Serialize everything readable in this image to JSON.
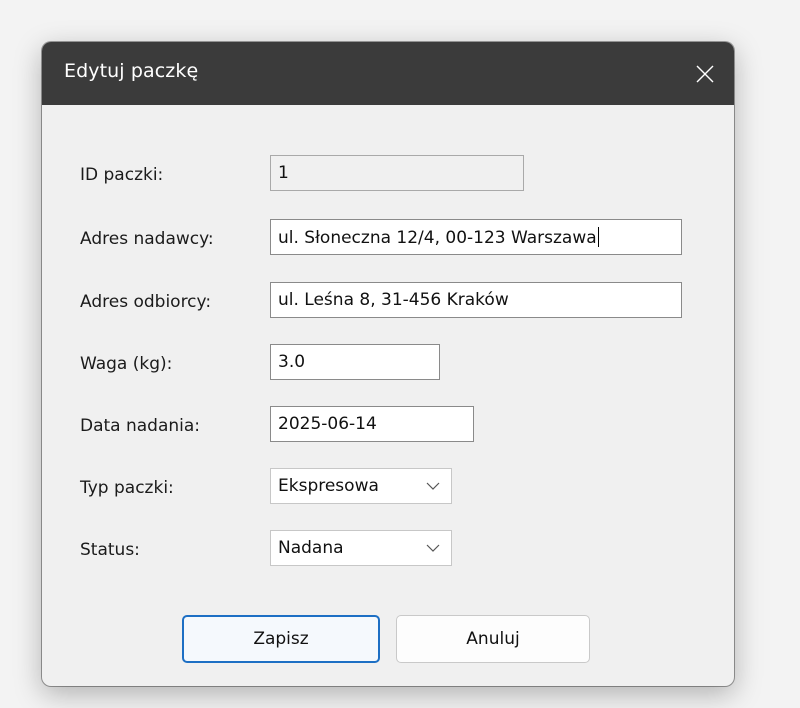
{
  "dialog": {
    "title": "Edytuj paczkę",
    "close_icon": "close-icon"
  },
  "form": {
    "id": {
      "label": "ID paczki:",
      "value": "1"
    },
    "sender": {
      "label": "Adres nadawcy:",
      "value": "ul. Słoneczna 12/4, 00-123 Warszawa"
    },
    "recipient": {
      "label": "Adres odbiorcy:",
      "value": "ul. Leśna 8, 31-456 Kraków"
    },
    "weight": {
      "label": "Waga (kg):",
      "value": "3.0"
    },
    "date": {
      "label": "Data nadania:",
      "value": "2025-06-14"
    },
    "type": {
      "label": "Typ paczki:",
      "selected": "Ekspresowa"
    },
    "status": {
      "label": "Status:",
      "selected": "Nadana"
    }
  },
  "buttons": {
    "save": "Zapisz",
    "cancel": "Anuluj"
  },
  "colors": {
    "titlebar": "#3b3b3b",
    "accent": "#1d6fc4",
    "background": "#f0f0f0"
  }
}
